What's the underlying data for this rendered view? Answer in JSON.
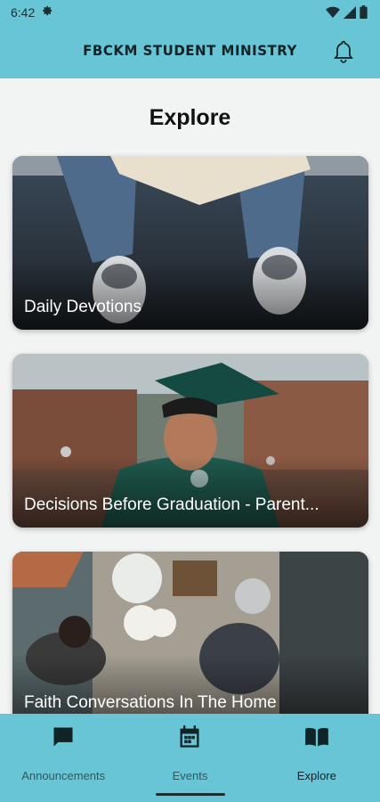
{
  "status_bar": {
    "time": "6:42",
    "icons": [
      "gear-icon",
      "wifi-icon",
      "signal-icon",
      "battery-icon"
    ]
  },
  "header": {
    "title": "FBCKM STUDENT MINISTRY",
    "icon": "bell-icon"
  },
  "page": {
    "title": "Explore"
  },
  "cards": [
    {
      "label": "Daily Devotions"
    },
    {
      "label": "Decisions Before Graduation - Parent..."
    },
    {
      "label": "Faith Conversations In The Home"
    }
  ],
  "bottom_nav": {
    "items": [
      {
        "label": "Announcements",
        "icon": "chat-icon"
      },
      {
        "label": "Events",
        "icon": "calendar-icon"
      },
      {
        "label": "Explore",
        "icon": "book-icon"
      }
    ],
    "active": "Explore"
  },
  "colors": {
    "brand": "#67c5d6",
    "background": "#f2f3f3",
    "text_dark": "#102326"
  }
}
